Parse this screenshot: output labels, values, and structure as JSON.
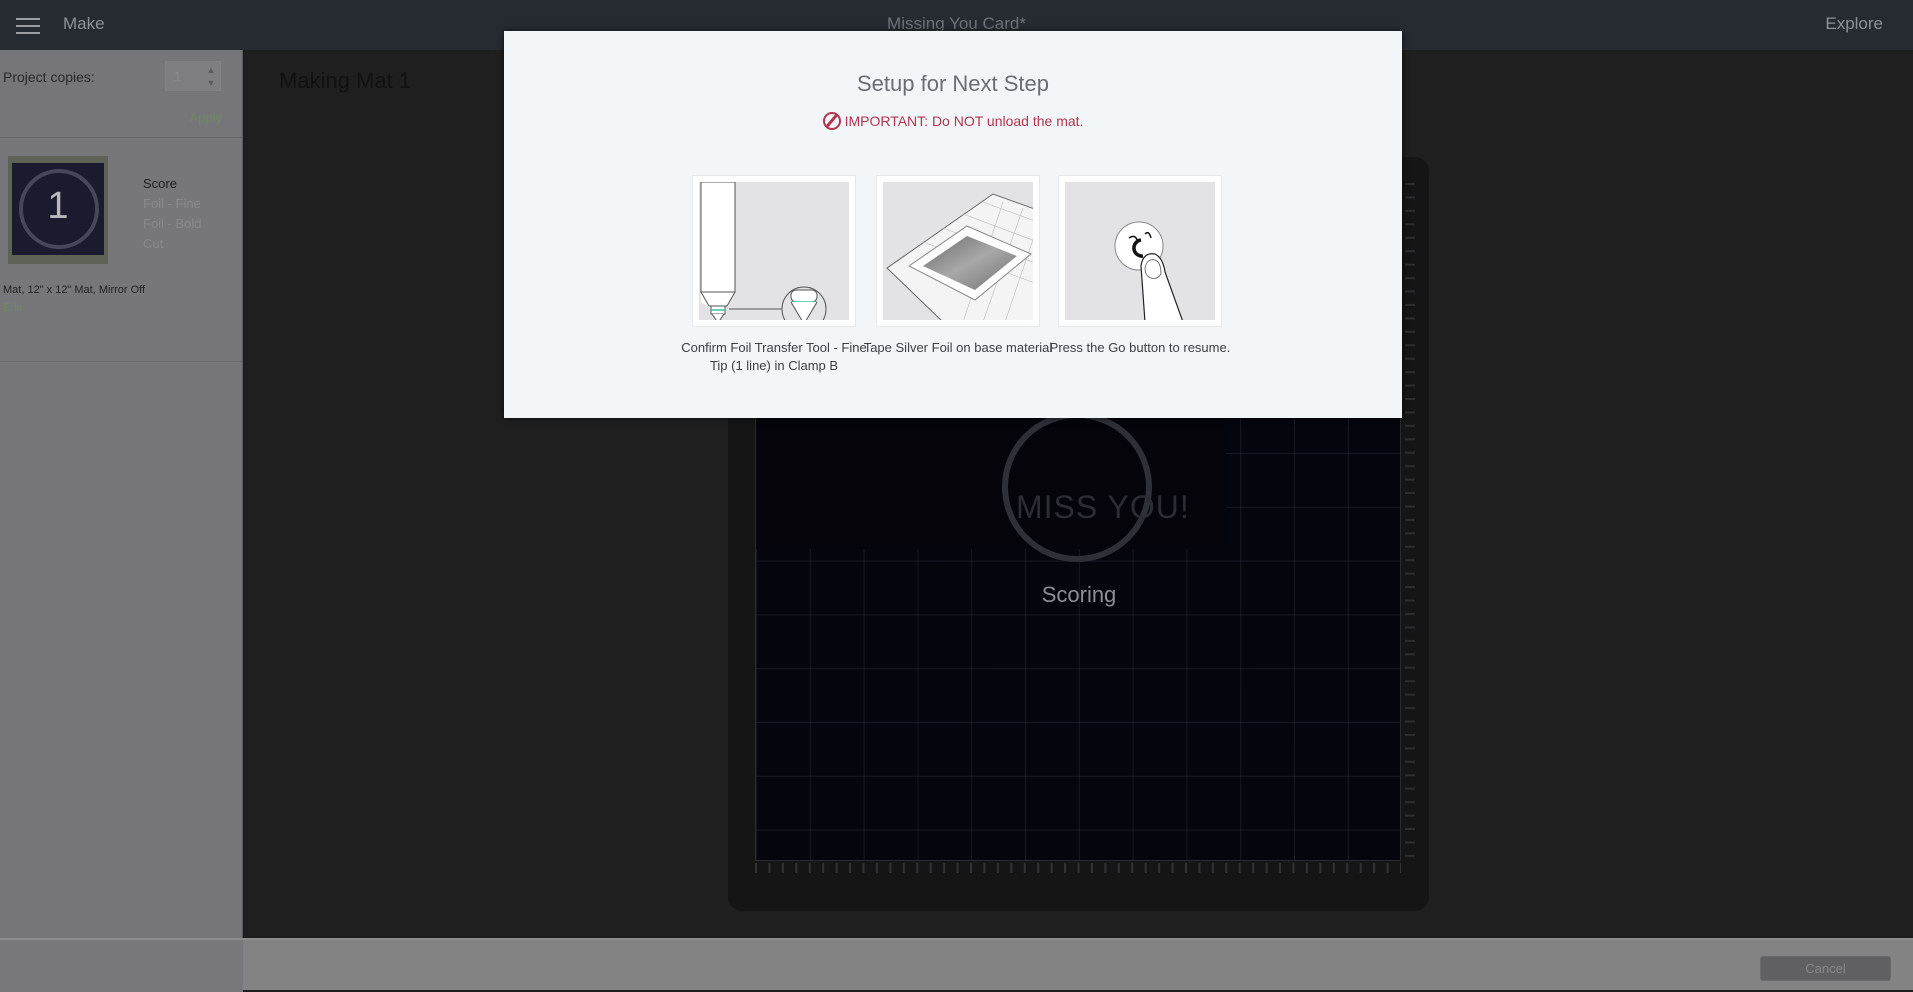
{
  "topbar": {
    "menu_icon": "hamburger-menu-icon",
    "section": "Make",
    "project_title": "Missing You Card*",
    "explore_label": "Explore"
  },
  "left_panel": {
    "copies_label": "Project copies:",
    "copies_value": "1",
    "apply_label": "Apply",
    "mat": {
      "number": "1",
      "operations": [
        {
          "label": "Score",
          "active": true
        },
        {
          "label": "Foil - Fine",
          "active": false
        },
        {
          "label": "Foil - Bold",
          "active": false
        },
        {
          "label": "Cut",
          "active": false
        }
      ],
      "description": "Mat, 12\" x 12\" Mat, Mirror Off",
      "edit_label": "Edit"
    }
  },
  "main": {
    "title": "Making Mat 1",
    "mat_design_text": "MISS YOU!",
    "status": "Scoring"
  },
  "bottombar": {
    "cancel_label": "Cancel"
  },
  "modal": {
    "title": "Setup for Next Step",
    "warning_icon": "no-entry-icon",
    "warning": "IMPORTANT: Do NOT unload the mat.",
    "steps": [
      {
        "illustration": "foil-transfer-tool-illustration",
        "caption": "Confirm Foil Transfer Tool - Fine Tip (1 line) in Clamp B"
      },
      {
        "illustration": "silver-foil-on-mat-illustration",
        "caption": "Tape Silver Foil on base material"
      },
      {
        "illustration": "press-go-button-illustration",
        "caption": "Press the Go button to resume."
      }
    ]
  },
  "colors": {
    "warning": "#b3364f",
    "link_green": "#6d8a5c",
    "topbar": "#262b31",
    "modal_bg": "#f3f6f9",
    "tool_accent": "#3fc0a8"
  }
}
